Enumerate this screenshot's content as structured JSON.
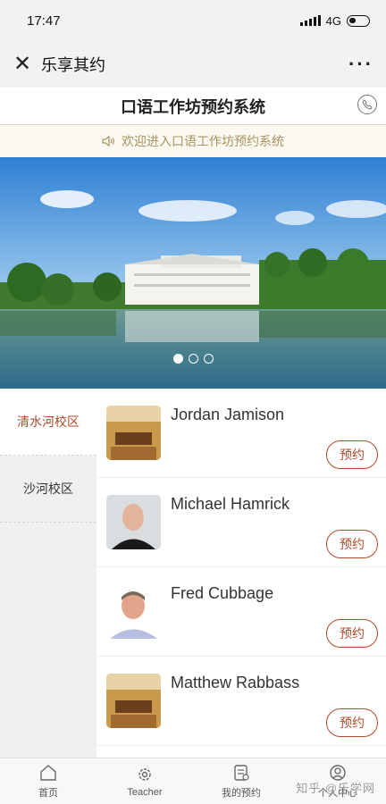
{
  "status": {
    "time": "17:47",
    "network": "4G"
  },
  "nav": {
    "title": "乐享其约",
    "more": "···"
  },
  "header": {
    "title": "口语工作坊预约系统"
  },
  "notice": {
    "text": "欢迎进入口语工作坊预约系统"
  },
  "banner": {
    "slide_count": 3,
    "active_slide": 1
  },
  "campuses": [
    {
      "label": "清水河校区",
      "active": true
    },
    {
      "label": "沙河校区",
      "active": false
    }
  ],
  "teachers": [
    {
      "name": "Jordan Jamison",
      "photo": "room-photo",
      "button": "预约"
    },
    {
      "name": "Michael Hamrick",
      "photo": "portrait-photo",
      "button": "预约"
    },
    {
      "name": "Fred Cubbage",
      "photo": "portrait-photo",
      "button": "预约"
    },
    {
      "name": "Matthew Rabbass",
      "photo": "room-photo",
      "button": "预约"
    }
  ],
  "tabs": [
    {
      "label": "首页",
      "icon": "home-icon"
    },
    {
      "label": "Teacher",
      "icon": "gear-icon"
    },
    {
      "label": "我的预约",
      "icon": "clipboard-icon"
    },
    {
      "label": "个人中心",
      "icon": "user-icon"
    }
  ],
  "watermark": "知乎 @乐学网",
  "colors": {
    "accent": "#b24a2b",
    "notice": "#a8945f"
  }
}
